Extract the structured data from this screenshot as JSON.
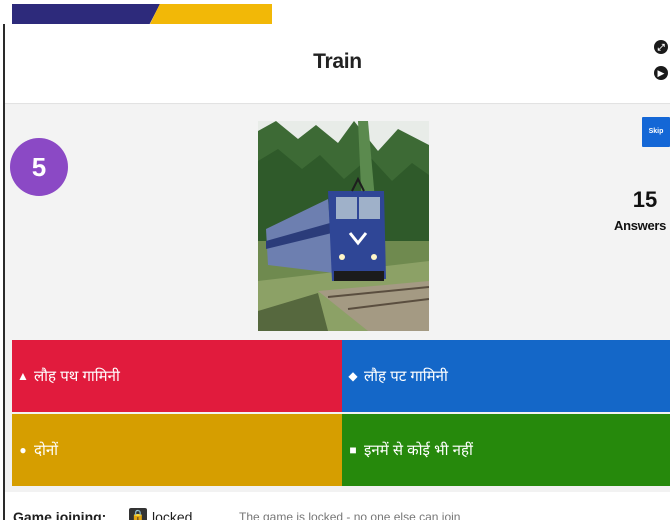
{
  "question": {
    "title": "Train",
    "timer": "5",
    "answers_count": "15",
    "answers_label": "Answers",
    "skip_label": "Skip"
  },
  "options": [
    {
      "shape": "triangle-icon",
      "glyph": "▲",
      "label": "लौह पथ गामिनी",
      "color": "#e11b3d"
    },
    {
      "shape": "diamond-icon",
      "glyph": "◆",
      "label": "लौह पट गामिनी",
      "color": "#1467c8"
    },
    {
      "shape": "circle-icon",
      "glyph": "●",
      "label": "दोनों",
      "color": "#d69e00"
    },
    {
      "shape": "square-icon",
      "glyph": "■",
      "label": "इनमें से कोई भी नहीं",
      "color": "#26890c"
    }
  ],
  "footer": {
    "join_label": "Game joining:",
    "locked_text": "locked",
    "lock_message": "The game is locked - no one else can join"
  },
  "colors": {
    "timer": "#8b49c5",
    "skip": "#1467d6",
    "stripe_navy": "#2d2a7b",
    "stripe_gold": "#f2b807"
  }
}
